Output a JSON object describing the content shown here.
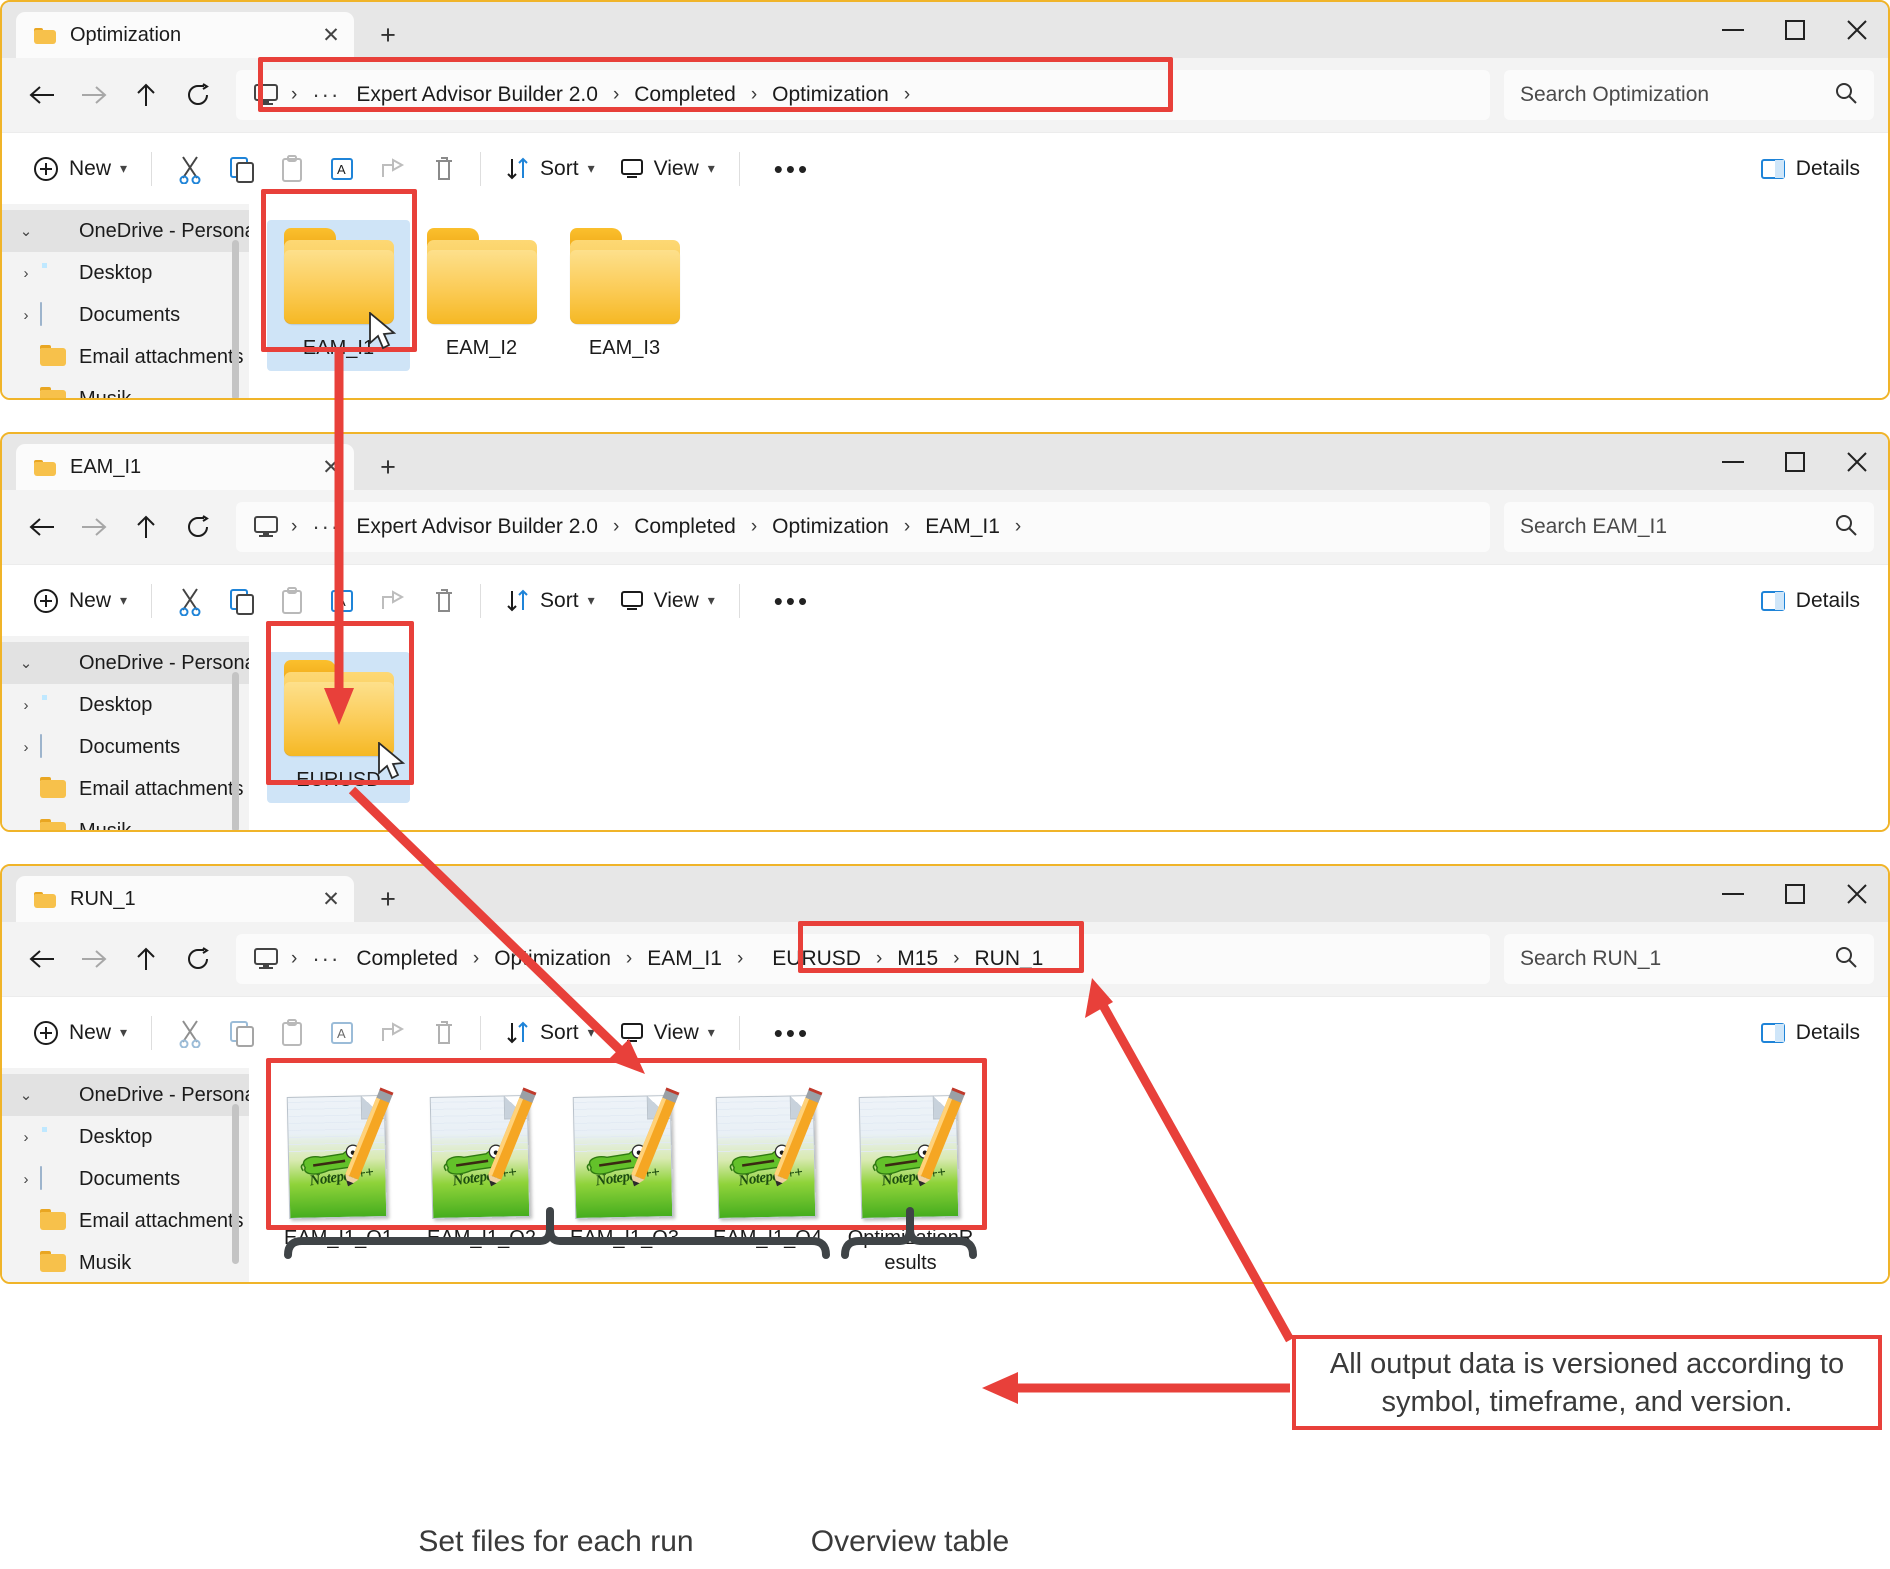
{
  "colors": {
    "annotation_red": "#e8403a",
    "window_border": "#f0b429",
    "selection_blue": "#cfe4f7",
    "folder_yellow": "#f7c14b"
  },
  "windows": [
    {
      "id": "win-optimization",
      "tab_title": "Optimization",
      "tab_close": "✕",
      "new_tab": "+",
      "breadcrumbs": [
        "Expert Advisor Builder 2.0",
        "Completed",
        "Optimization"
      ],
      "breadcrumb_trailing_sep": "›",
      "search_placeholder": "Search Optimization",
      "toolbar": {
        "new_label": "New",
        "sort_label": "Sort",
        "view_label": "View",
        "more_label": "•••",
        "details_label": "Details"
      },
      "sidebar": [
        {
          "label": "OneDrive - Personal",
          "icon": "cloud-icon",
          "caret": "⌄",
          "selected": true
        },
        {
          "label": "Desktop",
          "icon": "desktop-icon",
          "caret": "›",
          "selected": false
        },
        {
          "label": "Documents",
          "icon": "document-icon",
          "caret": "›",
          "selected": false
        },
        {
          "label": "Email attachments",
          "icon": "folder-icon",
          "caret": "",
          "selected": false
        },
        {
          "label": "Musik",
          "icon": "folder-icon",
          "caret": "",
          "selected": false
        }
      ],
      "items": [
        {
          "label": "EAM_I1",
          "type": "folder",
          "selected": true
        },
        {
          "label": "EAM_I2",
          "type": "folder",
          "selected": false
        },
        {
          "label": "EAM_I3",
          "type": "folder",
          "selected": false
        }
      ]
    },
    {
      "id": "win-eam-i1",
      "tab_title": "EAM_I1",
      "tab_close": "✕",
      "new_tab": "+",
      "breadcrumbs": [
        "Expert Advisor Builder 2.0",
        "Completed",
        "Optimization",
        "EAM_I1"
      ],
      "breadcrumb_trailing_sep": "›",
      "search_placeholder": "Search EAM_I1",
      "toolbar": {
        "new_label": "New",
        "sort_label": "Sort",
        "view_label": "View",
        "more_label": "•••",
        "details_label": "Details"
      },
      "sidebar": [
        {
          "label": "OneDrive - Personal",
          "icon": "cloud-icon",
          "caret": "⌄",
          "selected": true
        },
        {
          "label": "Desktop",
          "icon": "desktop-icon",
          "caret": "›",
          "selected": false
        },
        {
          "label": "Documents",
          "icon": "document-icon",
          "caret": "›",
          "selected": false
        },
        {
          "label": "Email attachments",
          "icon": "folder-icon",
          "caret": "",
          "selected": false
        },
        {
          "label": "Musik",
          "icon": "folder-icon",
          "caret": "",
          "selected": false
        }
      ],
      "items": [
        {
          "label": "EURUSD",
          "type": "folder",
          "selected": true
        }
      ]
    },
    {
      "id": "win-run-1",
      "tab_title": "RUN_1",
      "tab_close": "✕",
      "new_tab": "+",
      "breadcrumbs": [
        "Completed",
        "Optimization",
        "EAM_I1",
        "EURUSD",
        "M15",
        "RUN_1"
      ],
      "breadcrumb_trailing_sep": "",
      "search_placeholder": "Search RUN_1",
      "toolbar": {
        "new_label": "New",
        "sort_label": "Sort",
        "view_label": "View",
        "more_label": "•••",
        "details_label": "Details"
      },
      "sidebar": [
        {
          "label": "OneDrive - Personal",
          "icon": "cloud-icon",
          "caret": "⌄",
          "selected": true
        },
        {
          "label": "Desktop",
          "icon": "desktop-icon",
          "caret": "›",
          "selected": false
        },
        {
          "label": "Documents",
          "icon": "document-icon",
          "caret": "›",
          "selected": false
        },
        {
          "label": "Email attachments",
          "icon": "folder-icon",
          "caret": "",
          "selected": false
        },
        {
          "label": "Musik",
          "icon": "folder-icon",
          "caret": "",
          "selected": false
        }
      ],
      "items": [
        {
          "label": "EAM_I1_O1",
          "type": "notepadpp-file",
          "selected": false
        },
        {
          "label": "EAM_I1_O2",
          "type": "notepadpp-file",
          "selected": false
        },
        {
          "label": "EAM_I1_O3",
          "type": "notepadpp-file",
          "selected": false
        },
        {
          "label": "EAM_I1_O4",
          "type": "notepadpp-file",
          "selected": false
        },
        {
          "label": "OptimizationResults",
          "type": "notepadpp-file",
          "selected": false
        }
      ]
    }
  ],
  "annotations": {
    "callout_text": "All output data is versioned according to symbol, timeframe, and version.",
    "brace_label_left": "Set files for each run",
    "brace_label_right": "Overview table"
  },
  "file_icon": {
    "brand_text": "Notepad++"
  }
}
